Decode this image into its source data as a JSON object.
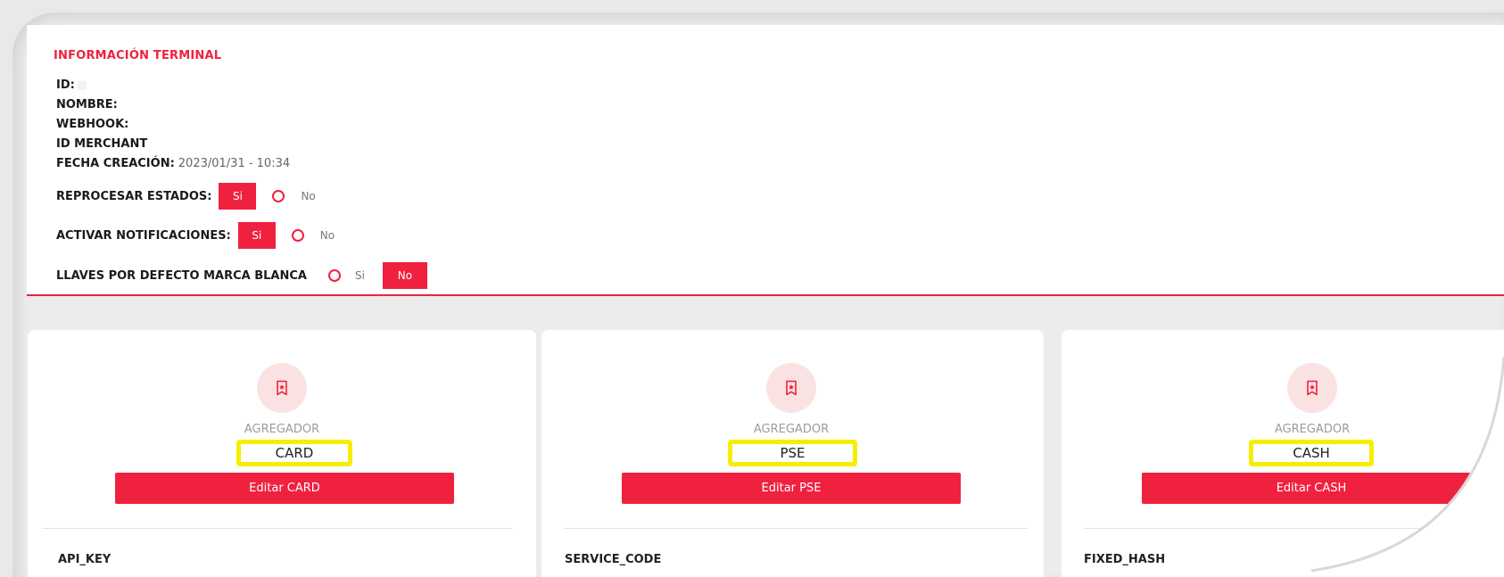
{
  "info": {
    "title": "INFORMACIÓN TERMINAL",
    "id_label": "ID:",
    "nombre_label": "NOMBRE:",
    "webhook_label": "WEBHOOK:",
    "merchant_label": "ID MERCHANT",
    "fecha_label": "FECHA CREACIÓN:",
    "fecha_value": "2023/01/31 - 10:34",
    "reprocesar": {
      "label": "REPROCESAR ESTADOS:",
      "selected": "Si",
      "other": "No"
    },
    "notificaciones": {
      "label": "ACTIVAR NOTIFICACIONES:",
      "selected": "Si",
      "other": "No"
    },
    "llaves": {
      "label": "LLAVES POR DEFECTO MARCA BLANCA",
      "other": "Si",
      "selected": "No"
    }
  },
  "cards": [
    {
      "agg_label": "AGREGADOR",
      "name": "CARD",
      "edit_label": "Editar CARD",
      "key_label": "API_KEY"
    },
    {
      "agg_label": "AGREGADOR",
      "name": "PSE",
      "edit_label": "Editar PSE",
      "key_label": "SERVICE_CODE"
    },
    {
      "agg_label": "AGREGADOR",
      "name": "CASH",
      "edit_label": "Editar CASH",
      "key_label": "FIXED_HASH"
    }
  ],
  "colors": {
    "accent": "#f0213f",
    "highlight": "#f6ee00",
    "icon_bg": "#fbe2e2"
  }
}
